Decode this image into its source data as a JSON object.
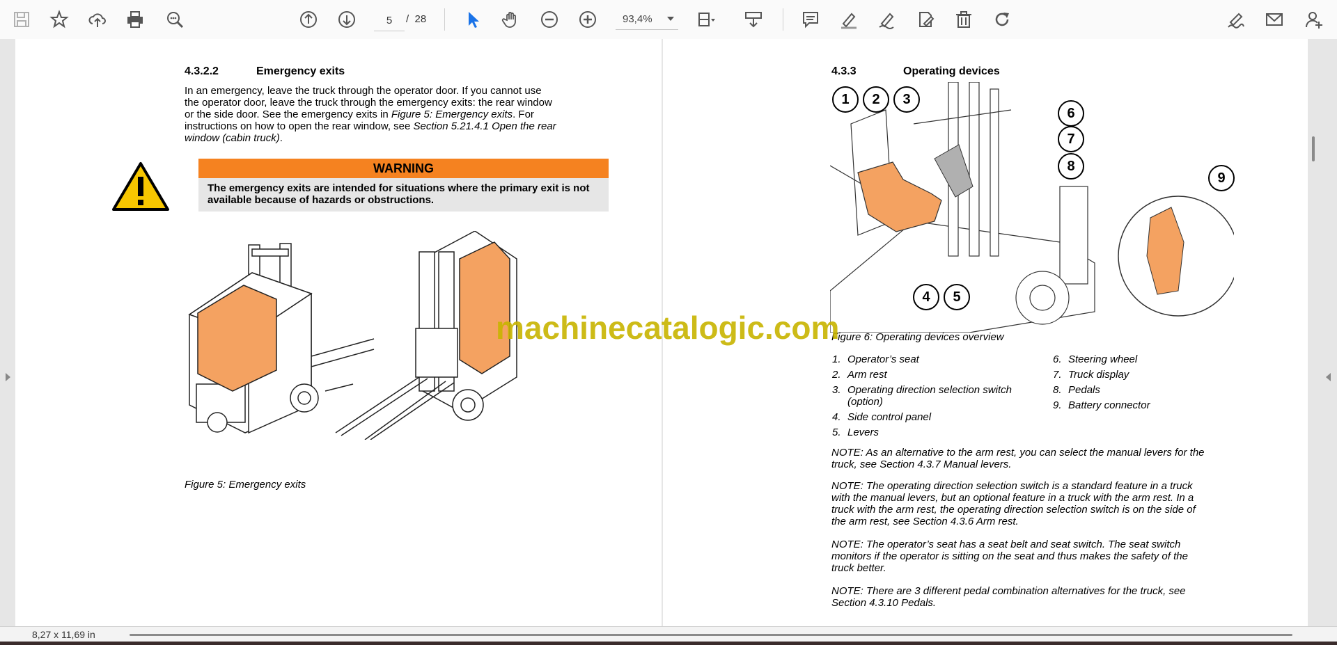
{
  "toolbar": {
    "icons": [
      "save-icon",
      "star-icon",
      "upload-cloud-icon",
      "print-icon",
      "zoom-search-icon",
      "page-up-icon",
      "page-down-icon",
      "select-cursor-icon",
      "hand-icon",
      "zoom-out-icon",
      "zoom-in-icon",
      "fit-page-icon",
      "scroll-mode-icon",
      "comment-icon",
      "highlight-icon",
      "draw-icon",
      "edit-doc-icon",
      "delete-icon",
      "rotate-icon",
      "sign-icon",
      "mail-icon",
      "add-user-icon"
    ],
    "current_page": "5",
    "page_separator": "/",
    "total_pages": "28",
    "zoom": "93,4%"
  },
  "left": {
    "section_number": "4.3.2.2",
    "section_title": "Emergency exits",
    "p1_line1": "In an emergency, leave the truck through the operator door. If you cannot use",
    "p1_line2": "the operator door, leave the truck through the emergency exits: the rear window",
    "p1_line3a": "or the side door. See the emergency exits in ",
    "p1_line3b": "Figure 5: Emergency exits",
    "p1_line3c": ". For",
    "p1_line4a": "instructions on how to open the rear window, see ",
    "p1_line4b": "Section 5.21.4.1 Open the rear",
    "p1_line5a": "window (cabin truck)",
    "p1_line5b": ".",
    "warning_title": "WARNING",
    "warning_text": "The emergency exits are intended for situations where the primary exit is not available because of hazards or obstructions.",
    "figure_caption": "Figure 5: Emergency exits"
  },
  "right": {
    "section_number": "4.3.3",
    "section_title": "Operating devices",
    "figure_caption": "Figure 6: Operating devices overview",
    "callouts": [
      "1",
      "2",
      "3",
      "4",
      "5",
      "6",
      "7",
      "8",
      "9"
    ],
    "list_left": [
      {
        "n": "1.",
        "t": "Operator’s seat"
      },
      {
        "n": "2.",
        "t": "Arm rest"
      },
      {
        "n": "3.",
        "t": "Operating direction selection switch"
      },
      {
        "n": "",
        "t": "(option)"
      },
      {
        "n": "4.",
        "t": "Side control panel"
      },
      {
        "n": "5.",
        "t": "Levers"
      }
    ],
    "list_right": [
      {
        "n": "6.",
        "t": "Steering wheel"
      },
      {
        "n": "7.",
        "t": "Truck display"
      },
      {
        "n": "8.",
        "t": "Pedals"
      },
      {
        "n": "9.",
        "t": "Battery connector"
      }
    ],
    "notes": [
      [
        "NOTE: As an alternative to the arm rest, you can select the manual levers for the",
        "truck, see Section 4.3.7 Manual levers."
      ],
      [
        "NOTE: The operating direction selection switch is a standard feature in a truck",
        "with the manual levers, but an optional feature in a truck with the arm rest. In a",
        "truck with the arm rest, the operating direction selection switch is on the side of",
        "the arm rest, see Section 4.3.6 Arm rest."
      ],
      [
        "NOTE: The operator’s seat has a seat belt and seat switch. The seat switch",
        "monitors if the operator is sitting on the seat and thus makes the safety of the",
        "truck better."
      ],
      [
        "NOTE: There are 3 different pedal combination alternatives for the truck, see",
        "Section 4.3.10 Pedals."
      ]
    ]
  },
  "watermark": "machinecatalogic.com",
  "status": {
    "page_size": "8,27 x 11,69 in"
  },
  "colors": {
    "warning_orange": "#f58220",
    "watermark": "#c8b400",
    "warning_grey": "#e6e6e6"
  }
}
